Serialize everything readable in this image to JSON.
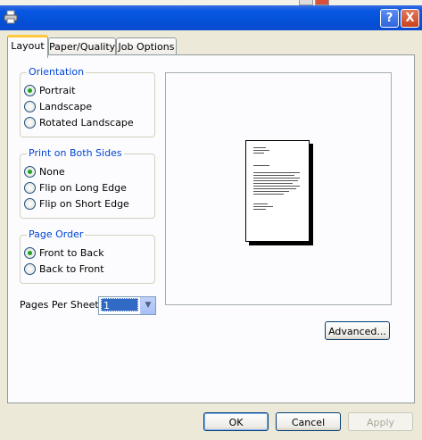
{
  "titlebar": {
    "help_label": "?",
    "close_label": "X"
  },
  "tabs": [
    {
      "label": "Layout",
      "active": true
    },
    {
      "label": "Paper/Quality",
      "active": false
    },
    {
      "label": "Job Options",
      "active": false
    }
  ],
  "orientation": {
    "legend": "Orientation",
    "options": [
      {
        "label": "Portrait",
        "checked": true
      },
      {
        "label": "Landscape",
        "checked": false
      },
      {
        "label": "Rotated Landscape",
        "checked": false
      }
    ]
  },
  "print_both_sides": {
    "legend": "Print on Both Sides",
    "options": [
      {
        "label": "None",
        "checked": true
      },
      {
        "label": "Flip on Long Edge",
        "checked": false
      },
      {
        "label": "Flip on Short Edge",
        "checked": false
      }
    ]
  },
  "page_order": {
    "legend": "Page Order",
    "options": [
      {
        "label": "Front to Back",
        "checked": true
      },
      {
        "label": "Back to Front",
        "checked": false
      }
    ]
  },
  "pages_per_sheet": {
    "label": "Pages Per Sheet:",
    "value": "1"
  },
  "buttons": {
    "advanced": "Advanced...",
    "ok": "OK",
    "cancel": "Cancel",
    "apply": "Apply"
  },
  "colors": {
    "title_bar": "#0451d8",
    "legend_text": "#0046d5",
    "dialog_bg": "#ece9d8",
    "tab_highlight": "#ffc83c"
  }
}
